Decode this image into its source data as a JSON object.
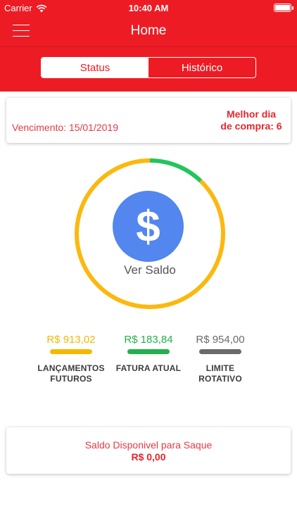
{
  "status_bar": {
    "carrier": "Carrier",
    "time": "10:40 AM"
  },
  "nav": {
    "title": "Home",
    "menu_icon": "hamburger-menu-icon"
  },
  "tabs": [
    {
      "label": "Status",
      "active": true
    },
    {
      "label": "Histórico",
      "active": false
    }
  ],
  "due_card": {
    "vencimento": "Vencimento: 15/01/2019",
    "melhor_dia_line1": "Melhor dia",
    "melhor_dia_line2": "de compra: 6"
  },
  "balance_ring": {
    "segments": [
      {
        "name": "fatura_atual",
        "fraction": 0.122,
        "color": "#22c55e"
      },
      {
        "name": "lancamentos_futuros",
        "fraction": 0.878,
        "color": "#fbb80f"
      }
    ],
    "center_icon": "dollar-icon",
    "center_label": "Ver Saldo"
  },
  "metrics": [
    {
      "value": "R$ 913,02",
      "label_line1": "LANÇAMENTOS",
      "label_line2": "FUTUROS",
      "color": "#f5b800"
    },
    {
      "value": "R$ 183,84",
      "label_line1": "FATURA ATUAL",
      "label_line2": "",
      "color": "#22b14c"
    },
    {
      "value": "R$ 954,00",
      "label_line1": "LIMITE",
      "label_line2": "ROTATIVO",
      "color": "#6a6a6a"
    }
  ],
  "withdraw_card": {
    "title": "Saldo Disponivel para Saque",
    "value": "R$ 0,00"
  },
  "colors": {
    "brand_red": "#ed1c24",
    "accent_blue": "#5386ee"
  }
}
